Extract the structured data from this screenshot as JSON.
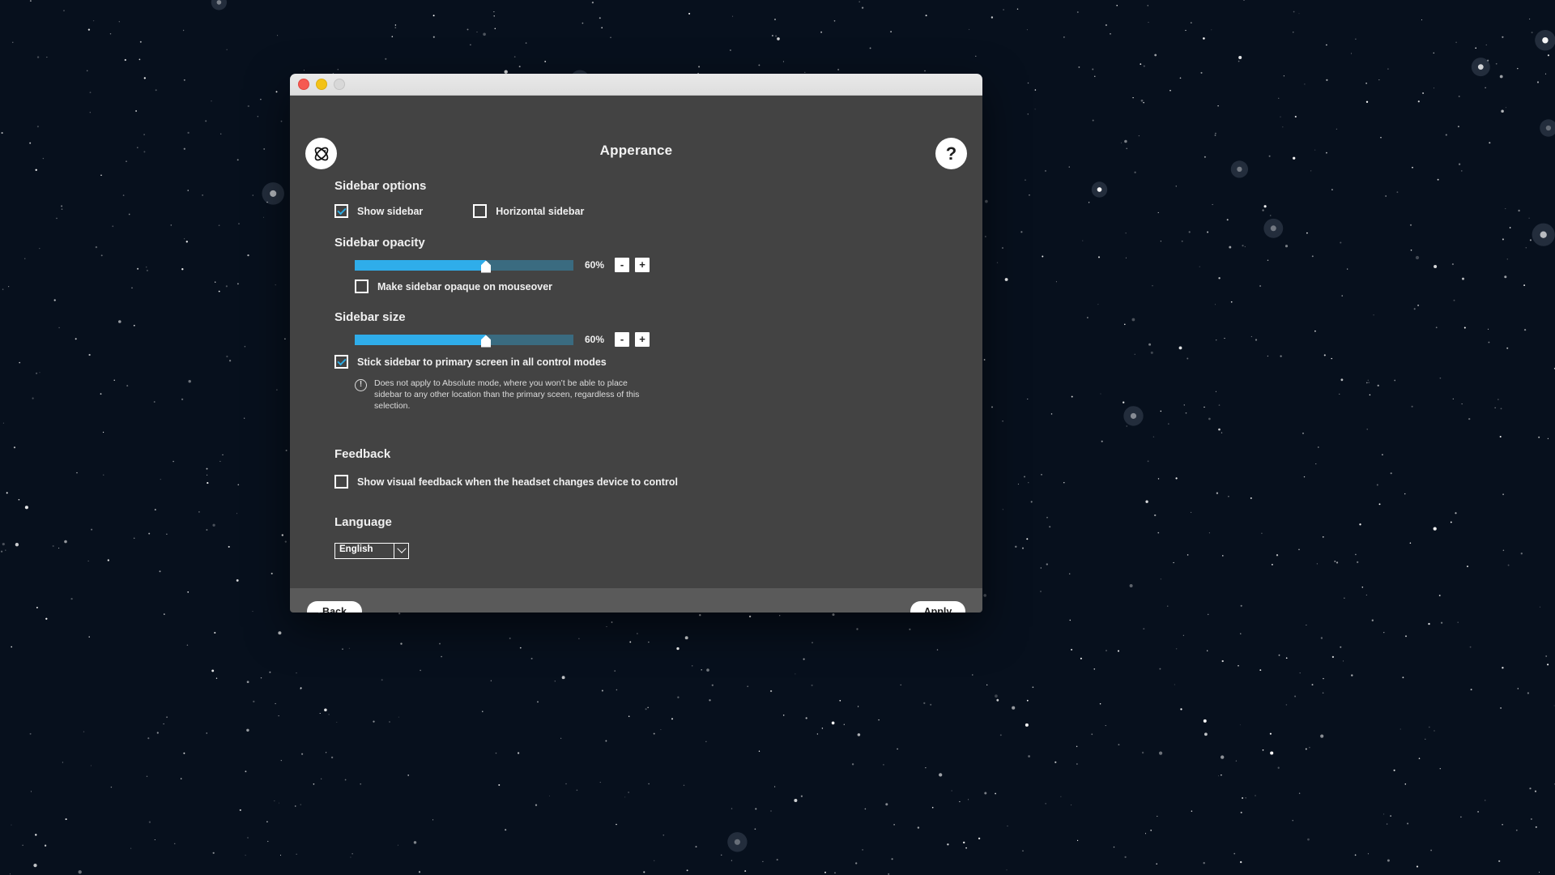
{
  "window": {
    "title": "Apperance",
    "logo_icon": "atom-logo-icon",
    "help_icon": "?",
    "traffic_lights": [
      {
        "name": "close",
        "color": "#f55a51"
      },
      {
        "name": "minimize",
        "color": "#f3c217"
      },
      {
        "name": "maximize",
        "color": "#d8d8d8"
      }
    ]
  },
  "sections": {
    "sidebar_options": {
      "heading": "Sidebar options",
      "show_sidebar": {
        "label": "Show sidebar",
        "checked": true
      },
      "horizontal_sidebar": {
        "label": "Horizontal sidebar",
        "checked": false
      },
      "opacity": {
        "label": "Sidebar opacity",
        "value": 60,
        "value_text": "60%",
        "minus_label": "-",
        "plus_label": "+"
      },
      "opaque_on_mouseover": {
        "label": "Make sidebar opaque on mouseover",
        "checked": false
      },
      "size": {
        "label": "Sidebar size",
        "value": 60,
        "value_text": "60%",
        "minus_label": "-",
        "plus_label": "+"
      },
      "stick_sidebar": {
        "label": "Stick sidebar to primary screen in all control modes",
        "checked": true
      },
      "note": {
        "icon": "!",
        "text": "Does not apply to Absolute mode, where you won’t be able to place sidebar to any other location than the primary sceen, regardless of this selection."
      }
    },
    "feedback": {
      "heading": "Feedback",
      "visual_feedback": {
        "label": "Show visual feedback when the headset changes device to control",
        "checked": false
      }
    },
    "language": {
      "heading": "Language",
      "selected": "English"
    }
  },
  "footer": {
    "back_label": "Back",
    "apply_label": "Apply"
  },
  "colors": {
    "accent": "#2fadea",
    "slider_track": "#3a6b80",
    "window_bg": "#434343",
    "footer_bg": "#5a5a5a"
  }
}
